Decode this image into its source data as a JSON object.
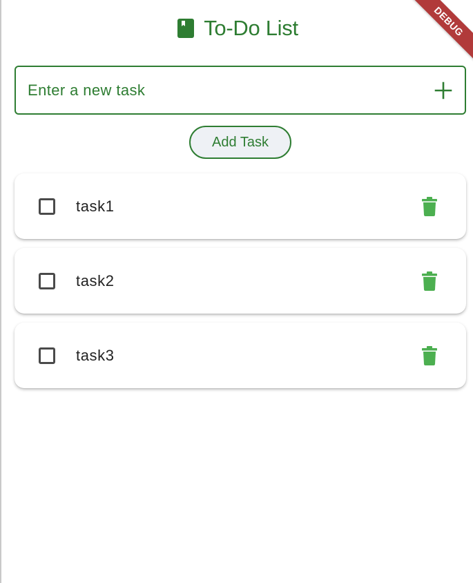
{
  "app": {
    "title": "To-Do List",
    "title_icon": "book-icon",
    "debug_banner": "DEBUG"
  },
  "input": {
    "placeholder": "Enter a new task",
    "value": "",
    "suffix_icon": "add-icon"
  },
  "add_button": {
    "label": "Add Task"
  },
  "tasks": [
    {
      "label": "task1",
      "checked": false,
      "delete_icon": "trash-icon"
    },
    {
      "label": "task2",
      "checked": false,
      "delete_icon": "trash-icon"
    },
    {
      "label": "task3",
      "checked": false,
      "delete_icon": "trash-icon"
    }
  ],
  "colors": {
    "primary": "#2e7d32",
    "delete": "#4caf50",
    "debug_ribbon": "#b13a3a",
    "button_bg": "#eef1f5"
  }
}
